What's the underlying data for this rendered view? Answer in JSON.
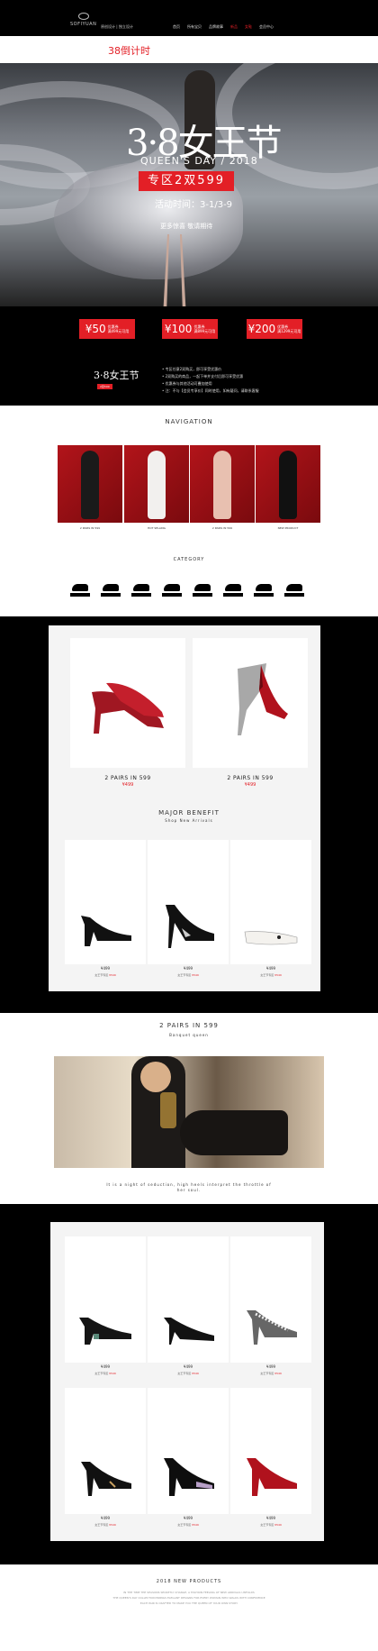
{
  "header": {
    "brand": "SOFIYUAN",
    "brand_sub": "原创设计 | 独立设计",
    "nav": [
      "首页",
      "所有宝贝",
      "品牌故事",
      "新品",
      "女鞋",
      "会员中心"
    ],
    "countdown": "38倒计时"
  },
  "hero": {
    "title": "3·8女王节",
    "subtitle": "QUEEN'S DAY / 2018",
    "badge": "专区2双599",
    "date": "活动时间：3-1/3-9",
    "note": "更多惊喜 敬请期待"
  },
  "promo": {
    "coupons": [
      {
        "amount": "¥50",
        "label": "优惠券",
        "cond": "满499元可用"
      },
      {
        "amount": "¥100",
        "label": "优惠券",
        "cond": "满899元可用"
      },
      {
        "amount": "¥200",
        "label": "优惠券",
        "cond": "满1299元可用"
      }
    ],
    "logo": "3·8女王节",
    "logo_badge": "2双599",
    "rules": [
      "• 专区任意2双购买，即可享受优惠价",
      "• 2双购买的商品，一起下单并支付后即可享受优惠",
      "• 优惠券与其他活动可叠加使用",
      "• 注：不与【会员专享价】同时使用，如有疑问，请联系客服"
    ]
  },
  "navigation": {
    "title": "NAVIGATION",
    "looks": [
      "2 PAIRS IN 599",
      "HOT SELLING",
      "2 PAIRS IN 599",
      "NEW PRODUCT"
    ]
  },
  "category": {
    "title": "CATEGORY",
    "items": [
      "",
      "",
      "",
      "",
      "",
      "",
      "",
      ""
    ]
  },
  "section1": {
    "products": [
      {
        "title": "2 PAIRS IN 599",
        "price": "¥499"
      },
      {
        "title": "2 PAIRS IN 599",
        "price": "¥499"
      }
    ],
    "benefit_title": "MAJOR BENEFIT",
    "benefit_sub": "Shop New Arrivals",
    "minis": [
      {
        "price": "¥499",
        "desc": "女王节专区",
        "orig": "¥549"
      },
      {
        "price": "¥499",
        "desc": "女王节专区",
        "orig": "¥549"
      },
      {
        "price": "¥499",
        "desc": "女王节专区",
        "orig": "¥549"
      }
    ]
  },
  "section2": {
    "title": "2 PAIRS IN 599",
    "subtitle": "Banquet queen",
    "caption_1": "It is a night of seduction, high heels interpret the throttle of",
    "caption_2": "her soul.",
    "minis": [
      {
        "price": "¥499",
        "desc": "女王节专区",
        "orig": "¥549"
      },
      {
        "price": "¥499",
        "desc": "女王节专区",
        "orig": "¥549"
      },
      {
        "price": "¥499",
        "desc": "女王节专区",
        "orig": "¥549"
      },
      {
        "price": "¥499",
        "desc": "女王节专区",
        "orig": "¥549"
      },
      {
        "price": "¥499",
        "desc": "女王节专区",
        "orig": "¥549"
      },
      {
        "price": "¥499",
        "desc": "女王节专区",
        "orig": "¥549"
      }
    ]
  },
  "footer": {
    "title": "2018 NEW PRODUCTS",
    "lines": [
      "IN THE TIME THE SEASONS SECRETLY CHANGE, A FASHION FEELING OF NEW ARRIVALS UNFOLDS",
      "THE QUEEN'S DAY COLLECTION BRINGS ELEGANT DESIGNS FOR EVERY WOMAN WHO WALKS WITH CONFIDENCE",
      "EACH PAIR IS CRAFTED TO MAKE YOU THE QUEEN OF YOUR OWN STORY"
    ]
  },
  "colors": {
    "accent": "#e31f26",
    "dark": "#000000",
    "panel": "#f4f4f4"
  }
}
